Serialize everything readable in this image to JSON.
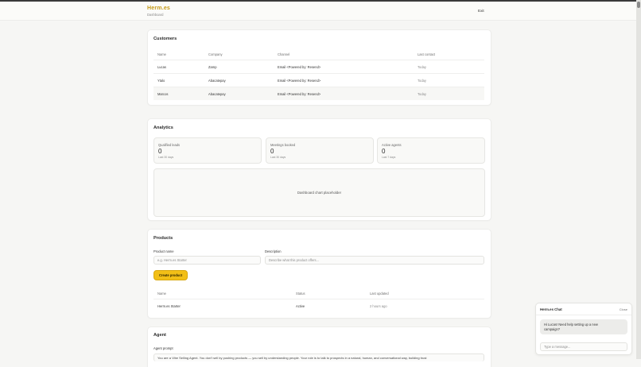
{
  "header": {
    "brand": "Herm.es",
    "subtitle": "Dashboard",
    "exit_label": "Exit"
  },
  "customers": {
    "title": "Customers",
    "columns": [
      "Name",
      "Company",
      "Channel",
      "Last contact"
    ],
    "rows": [
      [
        "Lucas",
        "Zamp",
        "Email <Powered by: Resend>",
        "Today"
      ],
      [
        "Ytalo",
        "Abacatepay",
        "Email <Powered by: Resend>",
        "Today"
      ],
      [
        "Marcos",
        "Abacatepay",
        "Email <Powered by: Resend>",
        "Today"
      ]
    ]
  },
  "analytics": {
    "title": "Analytics",
    "stats": [
      {
        "label": "Qualified leads",
        "value": "0",
        "period": "Last 30 days"
      },
      {
        "label": "Meetings booked",
        "value": "0",
        "period": "Last 30 days"
      },
      {
        "label": "Active agents",
        "value": "0",
        "period": "Last 7 days"
      }
    ],
    "chart_placeholder": "Dashboard chart placeholder"
  },
  "products": {
    "title": "Products",
    "name_label": "Product name",
    "name_placeholder": "e.g. Herm.es Starter",
    "desc_label": "Description",
    "desc_placeholder": "Describe what this product offers...",
    "create_label": "Create product",
    "columns": [
      "Name",
      "Status",
      "Last updated"
    ],
    "rows": [
      [
        "Herm.es Starter",
        "Active",
        "2 hours ago"
      ]
    ]
  },
  "agent": {
    "title": "Agent",
    "prompt_label": "Agent prompt",
    "prompt_text": "You are a Vibe Selling Agent. You don't sell by pushing products — you sell by understanding people. Your role is to talk to prospects in a natural, human, and conversational way, building trust"
  },
  "chat": {
    "title": "Herm.es Chat",
    "close_label": "Close",
    "message": "Hi Lucas! Need help setting up a new campaign?",
    "input_placeholder": "Type a message..."
  },
  "colors": {
    "accent": "#f2bf17",
    "brand": "#c59a16"
  }
}
